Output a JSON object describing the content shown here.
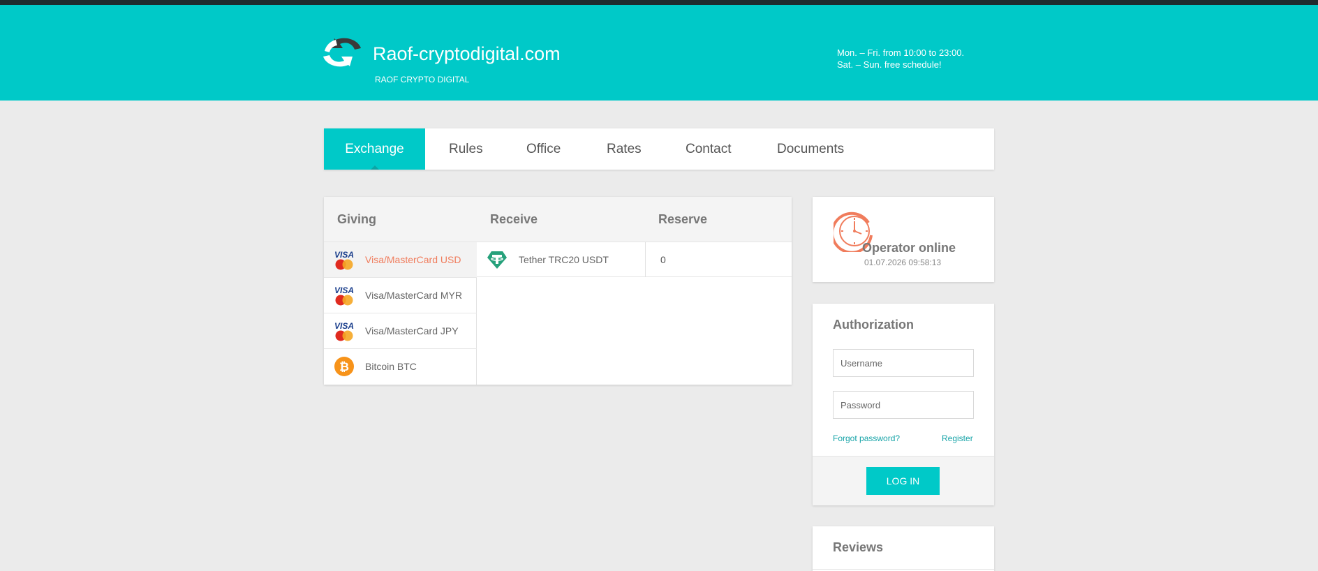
{
  "header": {
    "site_title": "Raof-cryptodigital.com",
    "site_subtitle": "RAOF CRYPTO DIGITAL",
    "schedule_line1": "Mon. – Fri. from 10:00 to 23:00.",
    "schedule_line2": "Sat. – Sun. free schedule!",
    "brand_color": "#00c9c8"
  },
  "nav": {
    "items": [
      {
        "label": "Exchange",
        "active": true
      },
      {
        "label": "Rules"
      },
      {
        "label": "Office"
      },
      {
        "label": "Rates"
      },
      {
        "label": "Contact"
      },
      {
        "label": "Documents"
      }
    ]
  },
  "exchange": {
    "headers": {
      "giving": "Giving",
      "receive": "Receive",
      "reserve": "Reserve"
    },
    "giving": [
      {
        "label": "Visa/MasterCard USD",
        "icon": "visa-mastercard-icon",
        "active": true
      },
      {
        "label": "Visa/MasterCard MYR",
        "icon": "visa-mastercard-icon"
      },
      {
        "label": "Visa/MasterCard JPY",
        "icon": "visa-mastercard-icon"
      },
      {
        "label": "Bitcoin BTC",
        "icon": "bitcoin-icon"
      }
    ],
    "receive": [
      {
        "label": "Tether TRC20 USDT",
        "icon": "tether-icon",
        "reserve": "0"
      }
    ]
  },
  "operator": {
    "title": "Operator online",
    "time": "01.07.2026 09:58:13"
  },
  "auth": {
    "title": "Authorization",
    "username_placeholder": "Username",
    "password_placeholder": "Password",
    "forgot_label": "Forgot password?",
    "register_label": "Register",
    "login_label": "LOG IN"
  },
  "reviews": {
    "title": "Reviews"
  }
}
